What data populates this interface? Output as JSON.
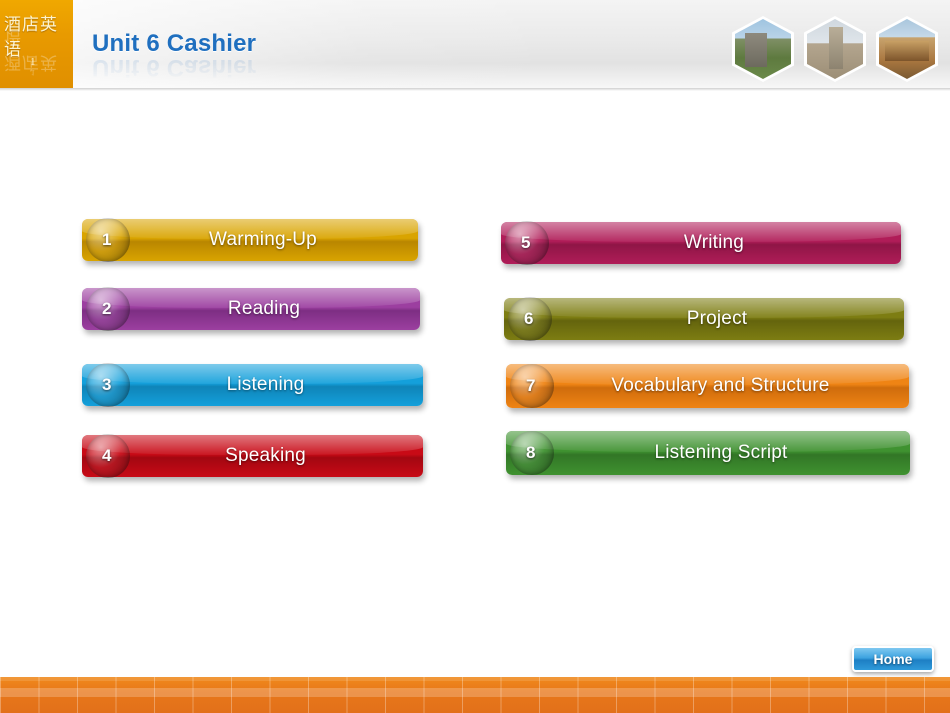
{
  "header": {
    "logo_cn": "酒店英语",
    "logo_number": "1",
    "title": "Unit 6 Cashier",
    "photos": [
      {
        "name": "photo-church"
      },
      {
        "name": "photo-tower"
      },
      {
        "name": "photo-street"
      }
    ]
  },
  "menu": {
    "left_column": [
      {
        "number": "1",
        "label": "Warming-Up",
        "color": "#d9a400",
        "color_dark": "#b98600"
      },
      {
        "number": "2",
        "label": "Reading",
        "color": "#9c3fa0",
        "color_dark": "#7d2e83"
      },
      {
        "number": "3",
        "label": "Listening",
        "color": "#14a0db",
        "color_dark": "#0f84b8"
      },
      {
        "number": "4",
        "label": "Speaking",
        "color": "#c80a16",
        "color_dark": "#a30711"
      }
    ],
    "right_column": [
      {
        "number": "5",
        "label": "Writing",
        "color": "#b01d58",
        "color_dark": "#8f1546"
      },
      {
        "number": "6",
        "label": "Project",
        "color": "#7d7d12",
        "color_dark": "#64640d"
      },
      {
        "number": "7",
        "label": "Vocabulary and Structure",
        "color": "#ef8414",
        "color_dark": "#cf6c0c"
      },
      {
        "number": "8",
        "label": "Listening Script",
        "color": "#3f9230",
        "color_dark": "#327626"
      }
    ]
  },
  "footer": {
    "home_label": "Home",
    "bar_color": "#e8781a"
  }
}
